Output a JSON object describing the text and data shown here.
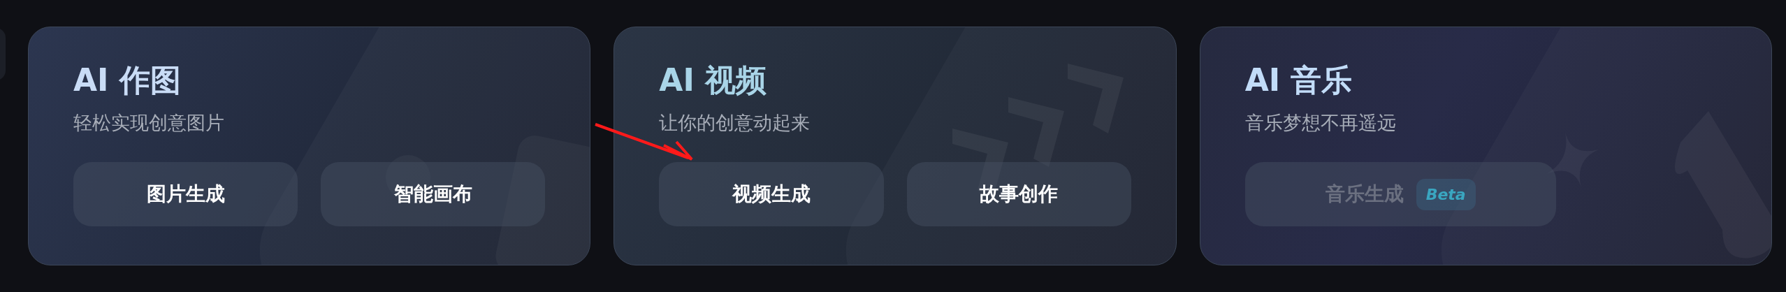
{
  "cards": [
    {
      "kind": "image",
      "title": "AI 作图",
      "subtitle": "轻松实现创意图片",
      "buttons": [
        {
          "label": "图片生成",
          "disabled": false
        },
        {
          "label": "智能画布",
          "disabled": false
        }
      ]
    },
    {
      "kind": "video",
      "title": "AI 视频",
      "subtitle": "让你的创意动起来",
      "buttons": [
        {
          "label": "视频生成",
          "disabled": false
        },
        {
          "label": "故事创作",
          "disabled": false
        }
      ]
    },
    {
      "kind": "music",
      "title": "AI 音乐",
      "subtitle": "音乐梦想不再遥远",
      "buttons": [
        {
          "label": "音乐生成",
          "badge": "Beta",
          "disabled": true
        }
      ]
    }
  ]
}
